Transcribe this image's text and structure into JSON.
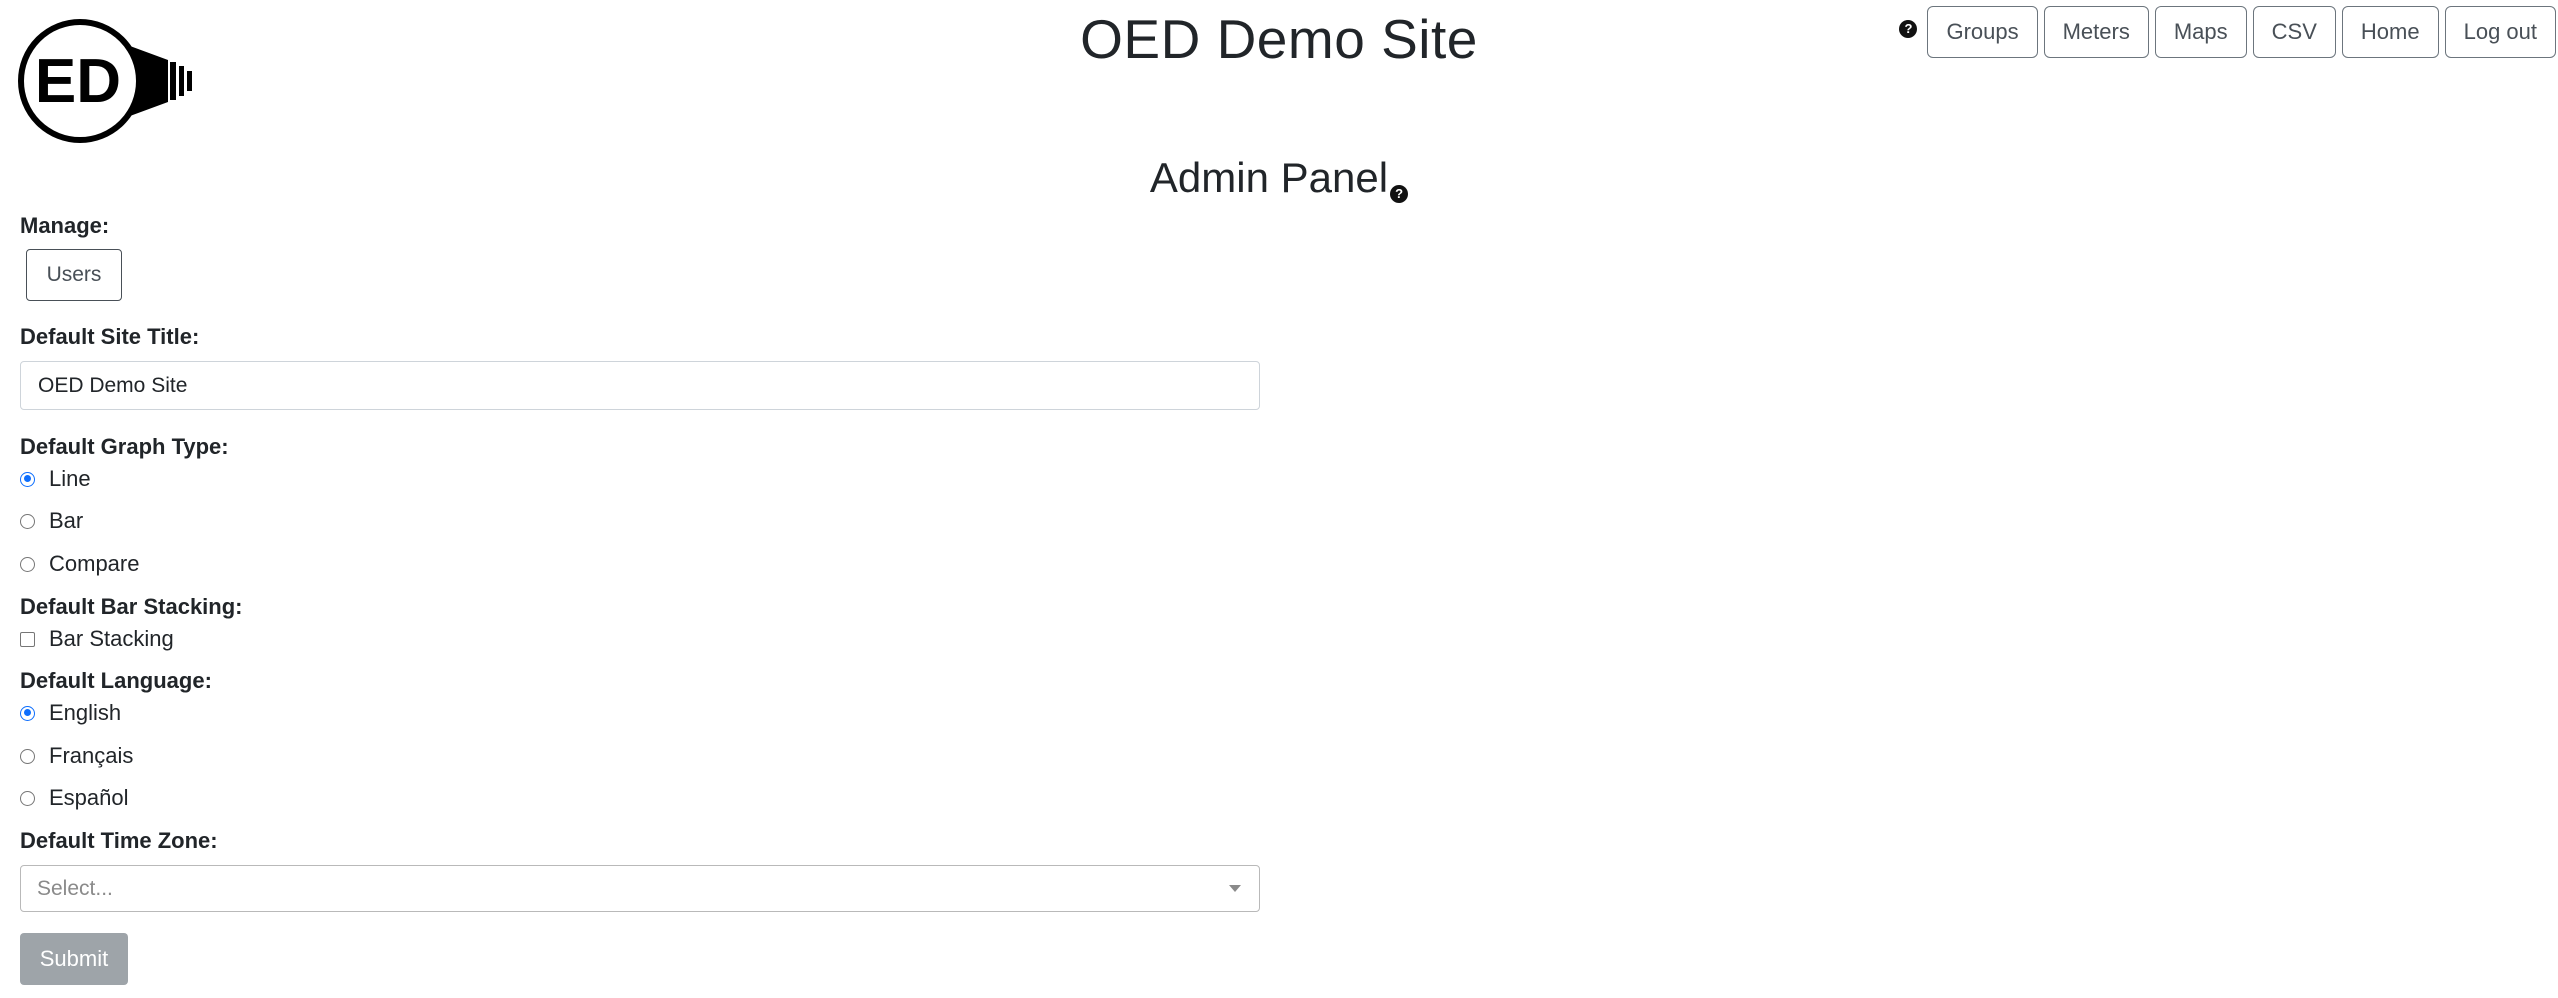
{
  "header": {
    "site_title": "OED Demo Site",
    "logo_text": "ED",
    "help_icon": "question-circle-icon",
    "nav": [
      {
        "label": "Groups"
      },
      {
        "label": "Meters"
      },
      {
        "label": "Maps"
      },
      {
        "label": "CSV"
      },
      {
        "label": "Home"
      },
      {
        "label": "Log out"
      }
    ]
  },
  "admin_panel": {
    "title": "Admin Panel",
    "manage_label": "Manage:",
    "users_button": "Users",
    "site_title_label": "Default Site Title:",
    "site_title_value": "OED Demo Site",
    "graph_type_label": "Default Graph Type:",
    "graph_types": [
      {
        "label": "Line",
        "checked": true
      },
      {
        "label": "Bar",
        "checked": false
      },
      {
        "label": "Compare",
        "checked": false
      }
    ],
    "bar_stacking_label": "Default Bar Stacking:",
    "bar_stacking_option": "Bar Stacking",
    "bar_stacking_checked": false,
    "language_label": "Default Language:",
    "languages": [
      {
        "label": "English",
        "checked": true
      },
      {
        "label": "Français",
        "checked": false
      },
      {
        "label": "Español",
        "checked": false
      }
    ],
    "time_zone_label": "Default Time Zone:",
    "time_zone_placeholder": "Select...",
    "submit_label": "Submit"
  },
  "colors": {
    "accent": "#0d6efd",
    "submit_disabled": "#9ea4a9",
    "button_border": "#6c757d"
  }
}
